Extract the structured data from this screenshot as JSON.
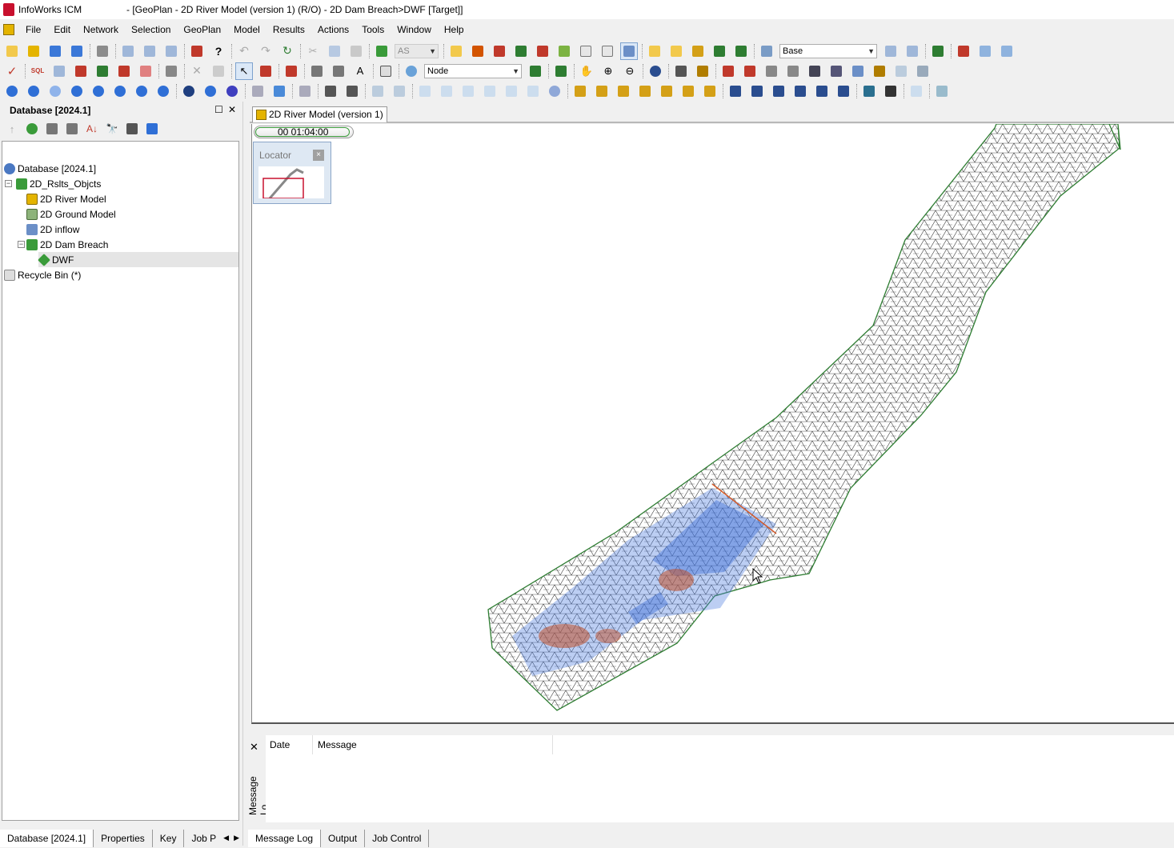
{
  "titlebar": {
    "app_name": "InfoWorks ICM",
    "document_title": "- [GeoPlan - 2D River Model (version 1) (R/O) - 2D Dam Breach>DWF  [Target]]"
  },
  "menu": {
    "items": [
      "File",
      "Edit",
      "Network",
      "Selection",
      "GeoPlan",
      "Model",
      "Results",
      "Actions",
      "Tools",
      "Window",
      "Help"
    ]
  },
  "toolbar": {
    "disabled_combo_value": "AS",
    "scenario_combo_value": "Base",
    "node_combo_value": "Node"
  },
  "database_panel": {
    "title": "Database [2024.1]",
    "tree": [
      {
        "label": "Database [2024.1]",
        "icon": "database-icon"
      },
      {
        "label": "2D_Rslts_Objcts",
        "icon": "model-group-icon"
      },
      {
        "label": "2D River Model",
        "icon": "network-icon"
      },
      {
        "label": "2D Ground Model",
        "icon": "ground-model-icon"
      },
      {
        "label": "2D inflow",
        "icon": "inflow-icon"
      },
      {
        "label": "2D Dam Breach",
        "icon": "run-icon"
      },
      {
        "label": "DWF",
        "icon": "simulation-icon"
      },
      {
        "label": "Recycle Bin (*)",
        "icon": "recycle-bin-icon"
      }
    ]
  },
  "left_tabs": [
    "Database [2024.1]",
    "Properties",
    "Key",
    "Job P"
  ],
  "document": {
    "tab_label": "2D River Model (version 1)",
    "time_display": "00 01:04:00",
    "locator_title": "Locator",
    "locator_close": "×"
  },
  "message_log": {
    "close": "✕",
    "vertical_title": "Message Lo",
    "columns": [
      "Date",
      "Message"
    ]
  },
  "right_tabs": [
    "Message Log",
    "Output",
    "Job Control"
  ],
  "colors": {
    "mesh_line": "#2b2b2b",
    "mesh_boundary": "#2e7d32",
    "flood_depth_blue": "#4f7fe0",
    "velocity_red": "#c0502a",
    "app_icon": "#c8102e"
  }
}
